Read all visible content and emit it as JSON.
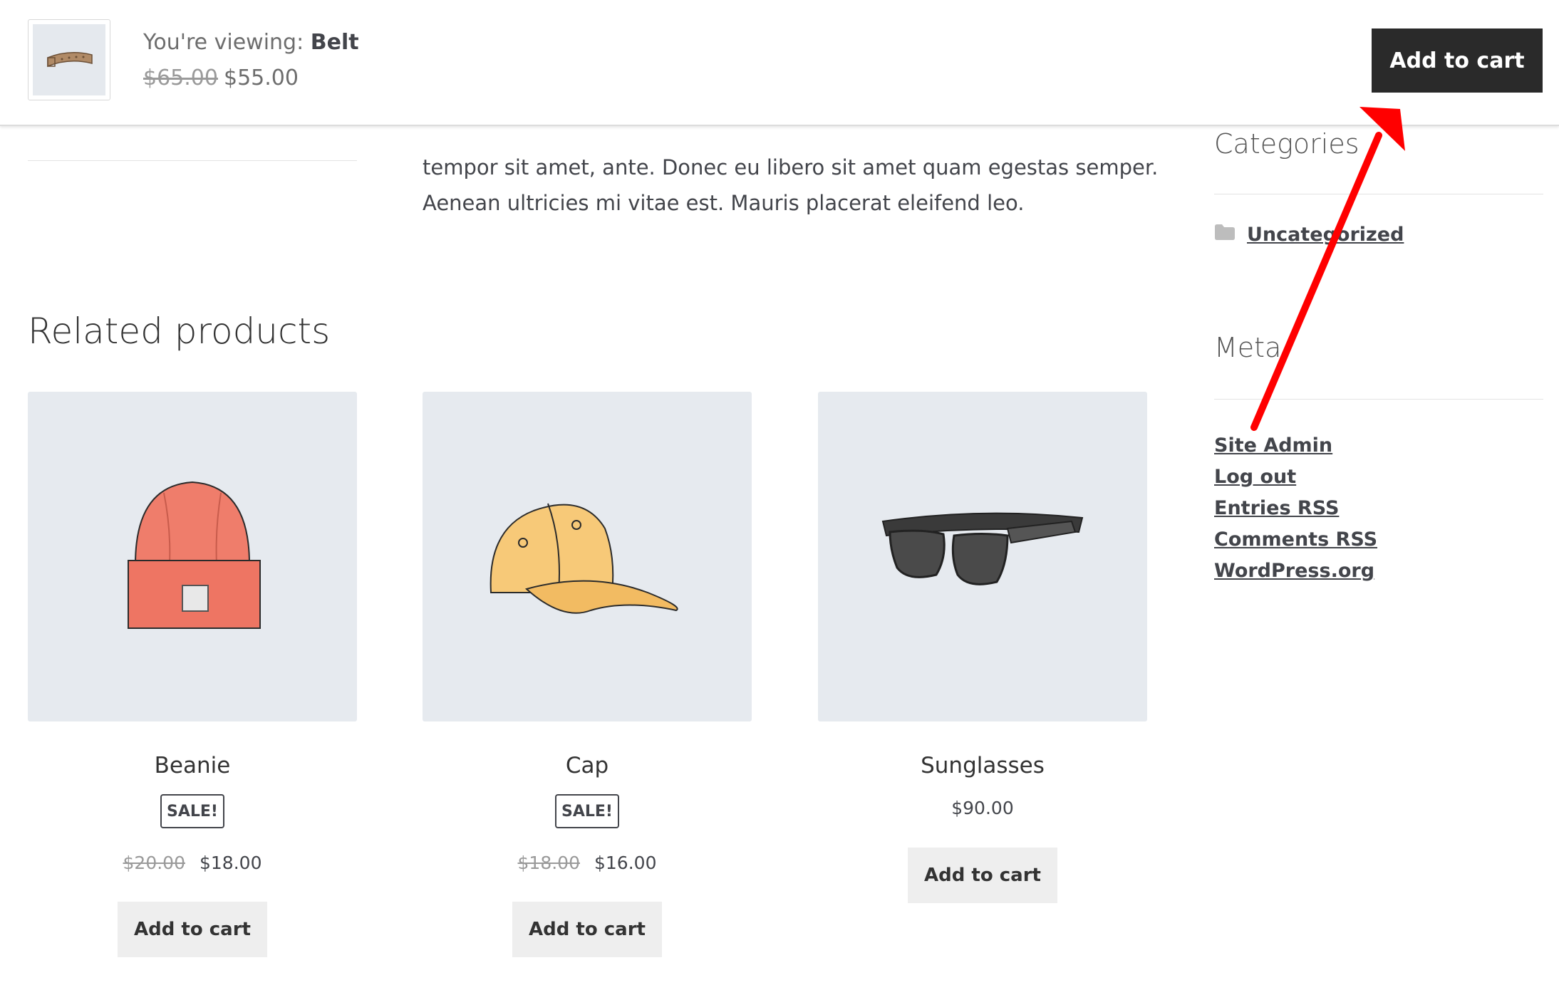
{
  "sticky": {
    "viewing_prefix": "You're viewing:",
    "product_name": "Belt",
    "old_price": "$65.00",
    "price": "$55.00",
    "cart_button": "Add to cart"
  },
  "description": {
    "line1": "tempor sit amet, ante. Donec eu libero sit amet quam egestas semper.",
    "line2": "Aenean ultricies mi vitae est. Mauris placerat eleifend leo."
  },
  "related": {
    "title": "Related products",
    "products": [
      {
        "name": "Beanie",
        "badge": "SALE!",
        "old_price": "$20.00",
        "price": "$18.00",
        "button": "Add to cart",
        "icon": "beanie-image"
      },
      {
        "name": "Cap",
        "badge": "SALE!",
        "old_price": "$18.00",
        "price": "$16.00",
        "button": "Add to cart",
        "icon": "cap-image"
      },
      {
        "name": "Sunglasses",
        "price": "$90.00",
        "button": "Add to cart",
        "icon": "sunglasses-image"
      }
    ]
  },
  "sidebar": {
    "categories_title": "Categories",
    "categories": [
      {
        "label": "Uncategorized",
        "icon": "folder-icon"
      }
    ],
    "meta_title": "Meta",
    "meta_links": [
      "Site Admin",
      "Log out",
      "Entries RSS",
      "Comments RSS",
      "WordPress.org"
    ]
  },
  "colors": {
    "sticky_button_bg": "#2a2a2a",
    "product_image_bg": "#e6eaef",
    "annotation_arrow": "#ff0000",
    "text": "#43454b"
  }
}
